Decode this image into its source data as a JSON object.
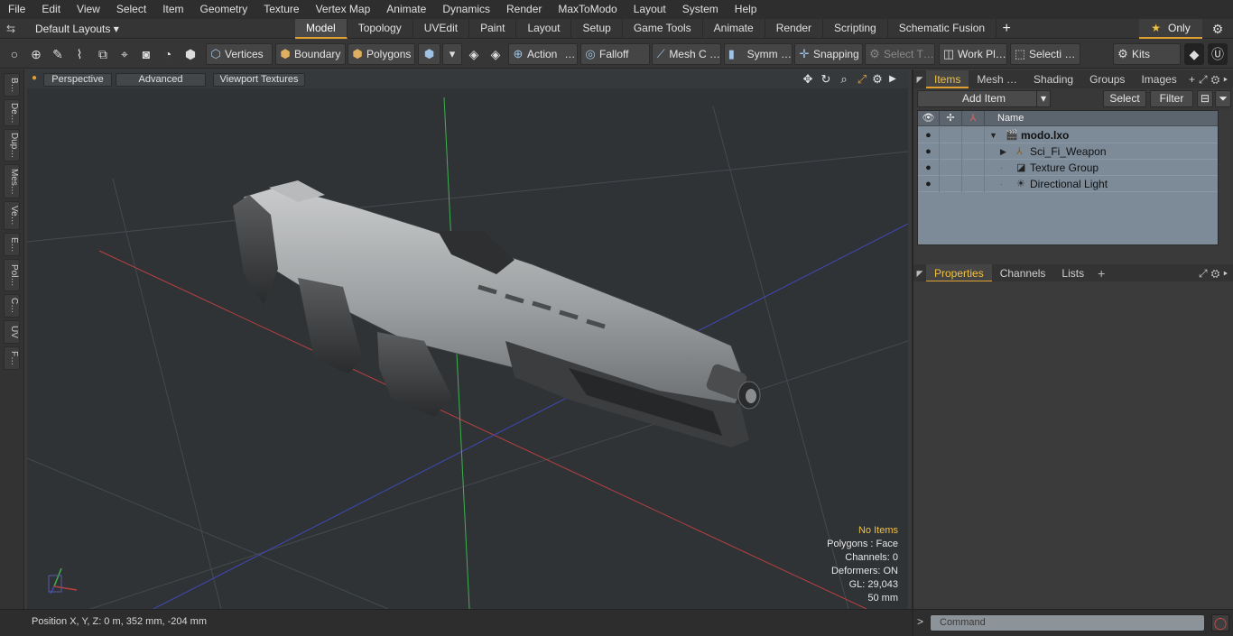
{
  "menu": [
    "File",
    "Edit",
    "View",
    "Select",
    "Item",
    "Geometry",
    "Texture",
    "Vertex Map",
    "Animate",
    "Dynamics",
    "Render",
    "MaxToModo",
    "Layout",
    "System",
    "Help"
  ],
  "layout_selector": {
    "label": "Default Layouts ▾"
  },
  "tabs": [
    "Model",
    "Topology",
    "UVEdit",
    "Paint",
    "Layout",
    "Setup",
    "Game Tools",
    "Animate",
    "Render",
    "Scripting",
    "Schematic Fusion"
  ],
  "active_tab": "Model",
  "only_button": "Only",
  "toolbar": {
    "vertices": "Vertices",
    "boundary": "Boundary",
    "polygons": "Polygons",
    "action": "Action",
    "action_dots": "…",
    "falloff": "Falloff",
    "mesh": "Mesh C …",
    "symm": "Symm …",
    "snapping": "Snapping",
    "select_t": "Select T…",
    "work_plane": "Work Pl…",
    "selection": "Selecti …",
    "kits": "Kits"
  },
  "left_strip": [
    "B…",
    "De…",
    "Dup…",
    "Mes…",
    "Ve…",
    "E…",
    "Pol…",
    "C…",
    "UV",
    "F…"
  ],
  "viewport": {
    "perspective": "Perspective",
    "advanced": "Advanced",
    "viewport_textures": "Viewport Textures",
    "info": {
      "no_items": "No Items",
      "polygons": "Polygons : Face",
      "channels": "Channels: 0",
      "deformers": "Deformers: ON",
      "gl": "GL: 29,043",
      "scale": "50 mm"
    }
  },
  "status": {
    "position": "Position X, Y, Z:   0 m, 352 mm, -204 mm"
  },
  "items_panel": {
    "tabs": [
      "Items",
      "Mesh …",
      "Shading",
      "Groups",
      "Images"
    ],
    "add_item": "Add Item",
    "select": "Select",
    "filter": "Filter",
    "name_header": "Name",
    "rows": [
      {
        "label": "modo.lxo"
      },
      {
        "label": "Sci_Fi_Weapon"
      },
      {
        "label": "Texture Group"
      },
      {
        "label": "Directional Light"
      }
    ]
  },
  "props_panel": {
    "tabs": [
      "Properties",
      "Channels",
      "Lists"
    ]
  },
  "command": {
    "placeholder": "Command"
  },
  "colors": {
    "accent": "#e0a030",
    "tree_bg": "#7d8b99",
    "viewport_bg": "#2f3336"
  }
}
